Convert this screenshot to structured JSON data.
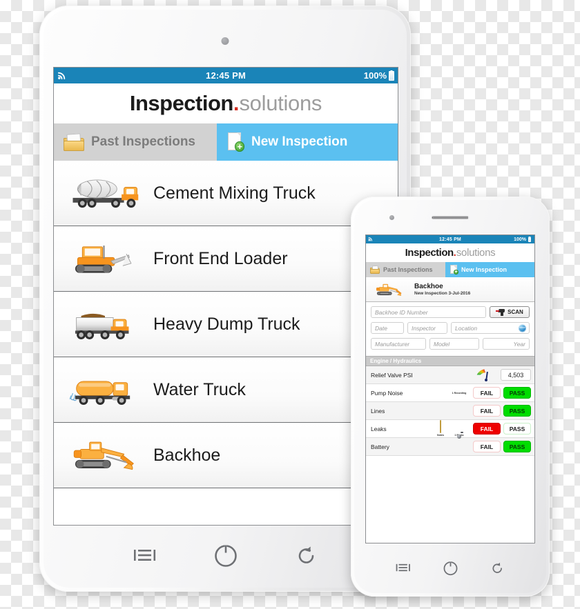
{
  "app": {
    "brand_strong": "Inspection",
    "brand_dot": ".",
    "brand_light": "solutions"
  },
  "status_bar": {
    "time": "12:45 PM",
    "battery_percent": "100%",
    "signal_icon": "rss-signal-icon",
    "battery_icon": "battery-full-icon"
  },
  "tabs": {
    "past_label": "Past Inspections",
    "past_icon": "folder-icon",
    "new_label": "New Inspection",
    "new_icon": "document-add-icon",
    "active": "New Inspection"
  },
  "tablet": {
    "equipment_list": [
      {
        "label": "Cement Mixing Truck",
        "icon": "cement-mixer-truck-icon"
      },
      {
        "label": "Front End Loader",
        "icon": "front-end-loader-icon"
      },
      {
        "label": "Heavy Dump Truck",
        "icon": "dump-truck-icon"
      },
      {
        "label": "Water Truck",
        "icon": "water-truck-icon"
      },
      {
        "label": "Backhoe",
        "icon": "backhoe-icon"
      }
    ]
  },
  "phone": {
    "subject": {
      "title": "Backhoe",
      "subtitle": "New Inspection 3-Jul-2016",
      "icon": "backhoe-icon"
    },
    "form": {
      "id_placeholder": "Backhoe ID Number",
      "scan_label": "SCAN",
      "scan_icon": "barcode-scanner-icon",
      "date_placeholder": "Date",
      "inspector_placeholder": "Inspector",
      "location_placeholder": "Location",
      "location_icon": "globe-icon",
      "manufacturer_placeholder": "Manufacturer",
      "model_placeholder": "Model",
      "year_placeholder": "Year"
    },
    "section": {
      "title": "Engine / Hydraulics"
    },
    "checks": [
      {
        "label": "Relief Valve PSI",
        "type": "gauge",
        "value": "4,503",
        "gauge_icon": "gauge-icon",
        "media": []
      },
      {
        "label": "Pump Noise",
        "type": "passfail",
        "fail_label": "FAIL",
        "pass_label": "PASS",
        "result": "PASS",
        "media": [
          {
            "icon": "microphone-icon",
            "label": "1 Recording"
          }
        ]
      },
      {
        "label": "Lines",
        "type": "passfail",
        "fail_label": "FAIL",
        "pass_label": "PASS",
        "result": "PASS",
        "media": []
      },
      {
        "label": "Leaks",
        "type": "passfail",
        "fail_label": "FAIL",
        "pass_label": "PASS",
        "result": "FAIL",
        "media": [
          {
            "icon": "notes-icon",
            "label": "Notes"
          },
          {
            "icon": "camera-icon",
            "label": "1 Photo"
          }
        ]
      },
      {
        "label": "Battery",
        "type": "passfail",
        "fail_label": "FAIL",
        "pass_label": "PASS",
        "result": "PASS",
        "media": []
      }
    ]
  },
  "device_nav": {
    "menu_icon": "menu-icon",
    "power_icon": "power-icon",
    "back_icon": "back-rotate-icon"
  },
  "colors": {
    "status_bar": "#1a84b8",
    "tab_active": "#5bc0f0",
    "tab_inactive": "#d2d2d2",
    "pass_green": "#00dd00",
    "fail_red": "#ee0000",
    "brand_red_dot": "#d62b1f",
    "brand_gray": "#9d9d9d",
    "section_header": "#c9c9c9"
  }
}
